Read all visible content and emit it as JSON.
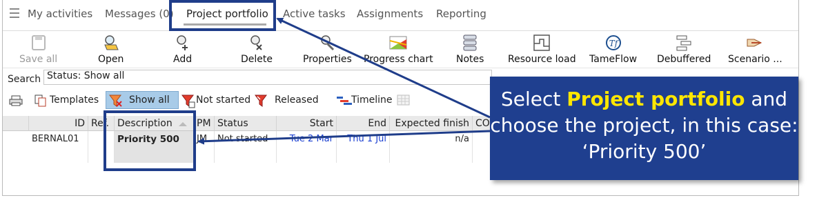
{
  "menu": {
    "items": [
      "My activities",
      "Messages (0)",
      "Project portfolio",
      "Active tasks",
      "Assignments",
      "Reporting"
    ]
  },
  "toolbar": {
    "save_all": "Save all",
    "open": "Open",
    "add": "Add",
    "delete": "Delete",
    "properties": "Properties",
    "progress_chart": "Progress chart",
    "notes": "Notes",
    "resource_load": "Resource load",
    "tameflow": "TameFlow",
    "debuffered": "Debuffered",
    "scenario": "Scenario ..."
  },
  "search": {
    "label": "Search",
    "value": "Status: Show all"
  },
  "filters": {
    "templates": "Templates",
    "show_all": "Show all",
    "not_started": "Not started",
    "released": "Released",
    "timeline": "Timeline"
  },
  "grid": {
    "headers": [
      "ID",
      "Ref.",
      "Description",
      "PM",
      "Status",
      "Start",
      "End",
      "Expected finish",
      "CO"
    ],
    "rows": [
      {
        "id": "BERNAL01",
        "ref": "",
        "description": "Priority 500",
        "pm": "JM",
        "status": "Not started",
        "start": "Tue 2 Mar",
        "end": "Thu 1 Jul",
        "expected_finish": "n/a"
      }
    ]
  },
  "callout": {
    "pre": "Select ",
    "highlight": "Project portfolio",
    "post": " and choose the project, in this case: ‘Priority 500’"
  },
  "colors": {
    "accent_navy": "#1f3f8f",
    "highlight_yellow": "#ffe600",
    "selected_button": "#a8cbe8",
    "date_blue": "#1a3fd1"
  }
}
